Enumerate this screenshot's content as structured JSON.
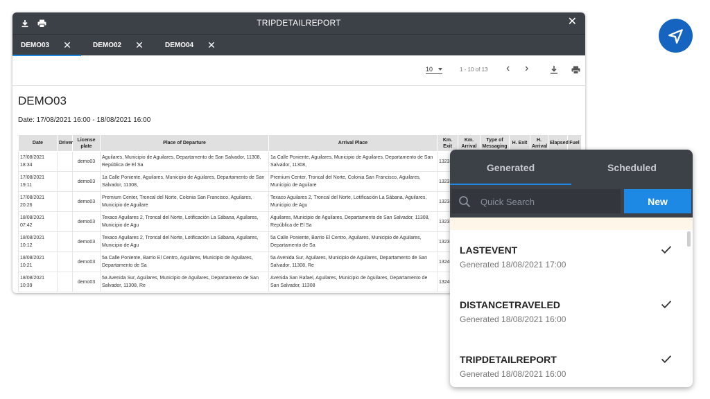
{
  "report_window": {
    "title": "TRIPDETAILREPORT",
    "close_label": "✕",
    "tabs": [
      {
        "label": "DEMO03",
        "active": true
      },
      {
        "label": "DEMO02",
        "active": false
      },
      {
        "label": "DEMO04",
        "active": false
      }
    ],
    "tab_close_label": "✕",
    "toolbar": {
      "page_size": "10",
      "page_info": "1 - 10 of 13",
      "prev_label": "‹",
      "next_label": "›"
    },
    "heading": "DEMO03",
    "date_range": "Date: 17/08/2021 16:00 - 18/08/2021 16:00",
    "columns": [
      "Date",
      "Driver",
      "License plate",
      "Place of Departure",
      "Arrival Place",
      "Km. Exit",
      "Km. Arrival",
      "Type of Messaging",
      "H. Exit",
      "H. Arrival",
      "Elapsed",
      "Fuel"
    ],
    "rows": [
      {
        "date": "17/08/2021 18:34",
        "driver": "",
        "plate": "demo03",
        "departure": "Aguilares, Municipio de Aguilares, Departamento de San Salvador, 11308, República de El Sa",
        "arrival": "1a Calle Poniente, Aguilares, Municipio de Aguilares, Departamento de San Salvador, 11308,",
        "km_exit": "13230"
      },
      {
        "date": "17/08/2021 19:11",
        "driver": "",
        "plate": "demo03",
        "departure": "1a Calle Poniente, Aguilares, Municipio de Aguilares, Departamento de San Salvador, 11308,",
        "arrival": "Premium Center, Troncal del Norte, Colonia San Francisco, Aguilares, Municipio de Aguilare",
        "km_exit": "13233"
      },
      {
        "date": "17/08/2021 20:26",
        "driver": "",
        "plate": "demo03",
        "departure": "Premium Center, Troncal del Norte, Colonia San Francisco, Aguilares, Municipio de Aguilare",
        "arrival": "Texaco Aguilares 2, Troncal del Norte, Lotificación La Sábana, Aguilares, Municipio de Agu",
        "km_exit": "13234"
      },
      {
        "date": "18/08/2021 07:42",
        "driver": "",
        "plate": "demo03",
        "departure": "Texaco Aguilares 2, Troncal del Norte, Lotificación La Sábana, Aguilares, Municipio de Agu",
        "arrival": "Aguilares, Municipio de Aguilares, Departamento de San Salvador, 11308, República de El Sa",
        "km_exit": "13235"
      },
      {
        "date": "18/08/2021 10:12",
        "driver": "",
        "plate": "demo03",
        "departure": "Texaco Aguilares 2, Troncal del Norte, Lotificación La Sábana, Aguilares, Municipio de Agu",
        "arrival": "5a Calle Poniente, Barrio El Centro, Aguilares, Municipio de Aguilares, Departamento de Sa",
        "km_exit": "13238"
      },
      {
        "date": "18/08/2021 10:21",
        "driver": "",
        "plate": "demo03",
        "departure": "5a Calle Poniente, Barrio El Centro, Aguilares, Municipio de Aguilares, Departamento de Sa",
        "arrival": "5a Avenida Sur, Aguilares, Municipio de Aguilares, Departamento de San Salvador, 11308, Re",
        "km_exit": "13240"
      },
      {
        "date": "18/08/2021 10:39",
        "driver": "",
        "plate": "demo03",
        "departure": "5a Avenida Sur, Aguilares, Municipio de Aguilares, Departamento de San Salvador, 11308, Re",
        "arrival": "Avenida San Rafael, Aguilares, Municipio de Aguilares, Departamento de San Salvador, 11308",
        "km_exit": "13240"
      }
    ]
  },
  "panel": {
    "tabs": [
      {
        "label": "Generated",
        "active": true
      },
      {
        "label": "Scheduled",
        "active": false
      }
    ],
    "search_placeholder": "Quick Search",
    "new_label": "New",
    "items": [
      {
        "name": "LASTEVENT",
        "generated": "Generated 18/08/2021 17:00"
      },
      {
        "name": "DISTANCETRAVELED",
        "generated": "Generated 18/08/2021 16:00"
      },
      {
        "name": "TRIPDETAILREPORT",
        "generated": "Generated 18/08/2021 16:00"
      }
    ]
  },
  "icons": [
    "download-icon",
    "print-icon",
    "close-icon",
    "chevron-left-icon",
    "chevron-right-icon",
    "search-icon",
    "checkmark-icon",
    "navigation-arrow-icon"
  ],
  "colors": {
    "dark_header": "#3c4148",
    "accent": "#1e88e5",
    "badge": "#1565c0"
  }
}
